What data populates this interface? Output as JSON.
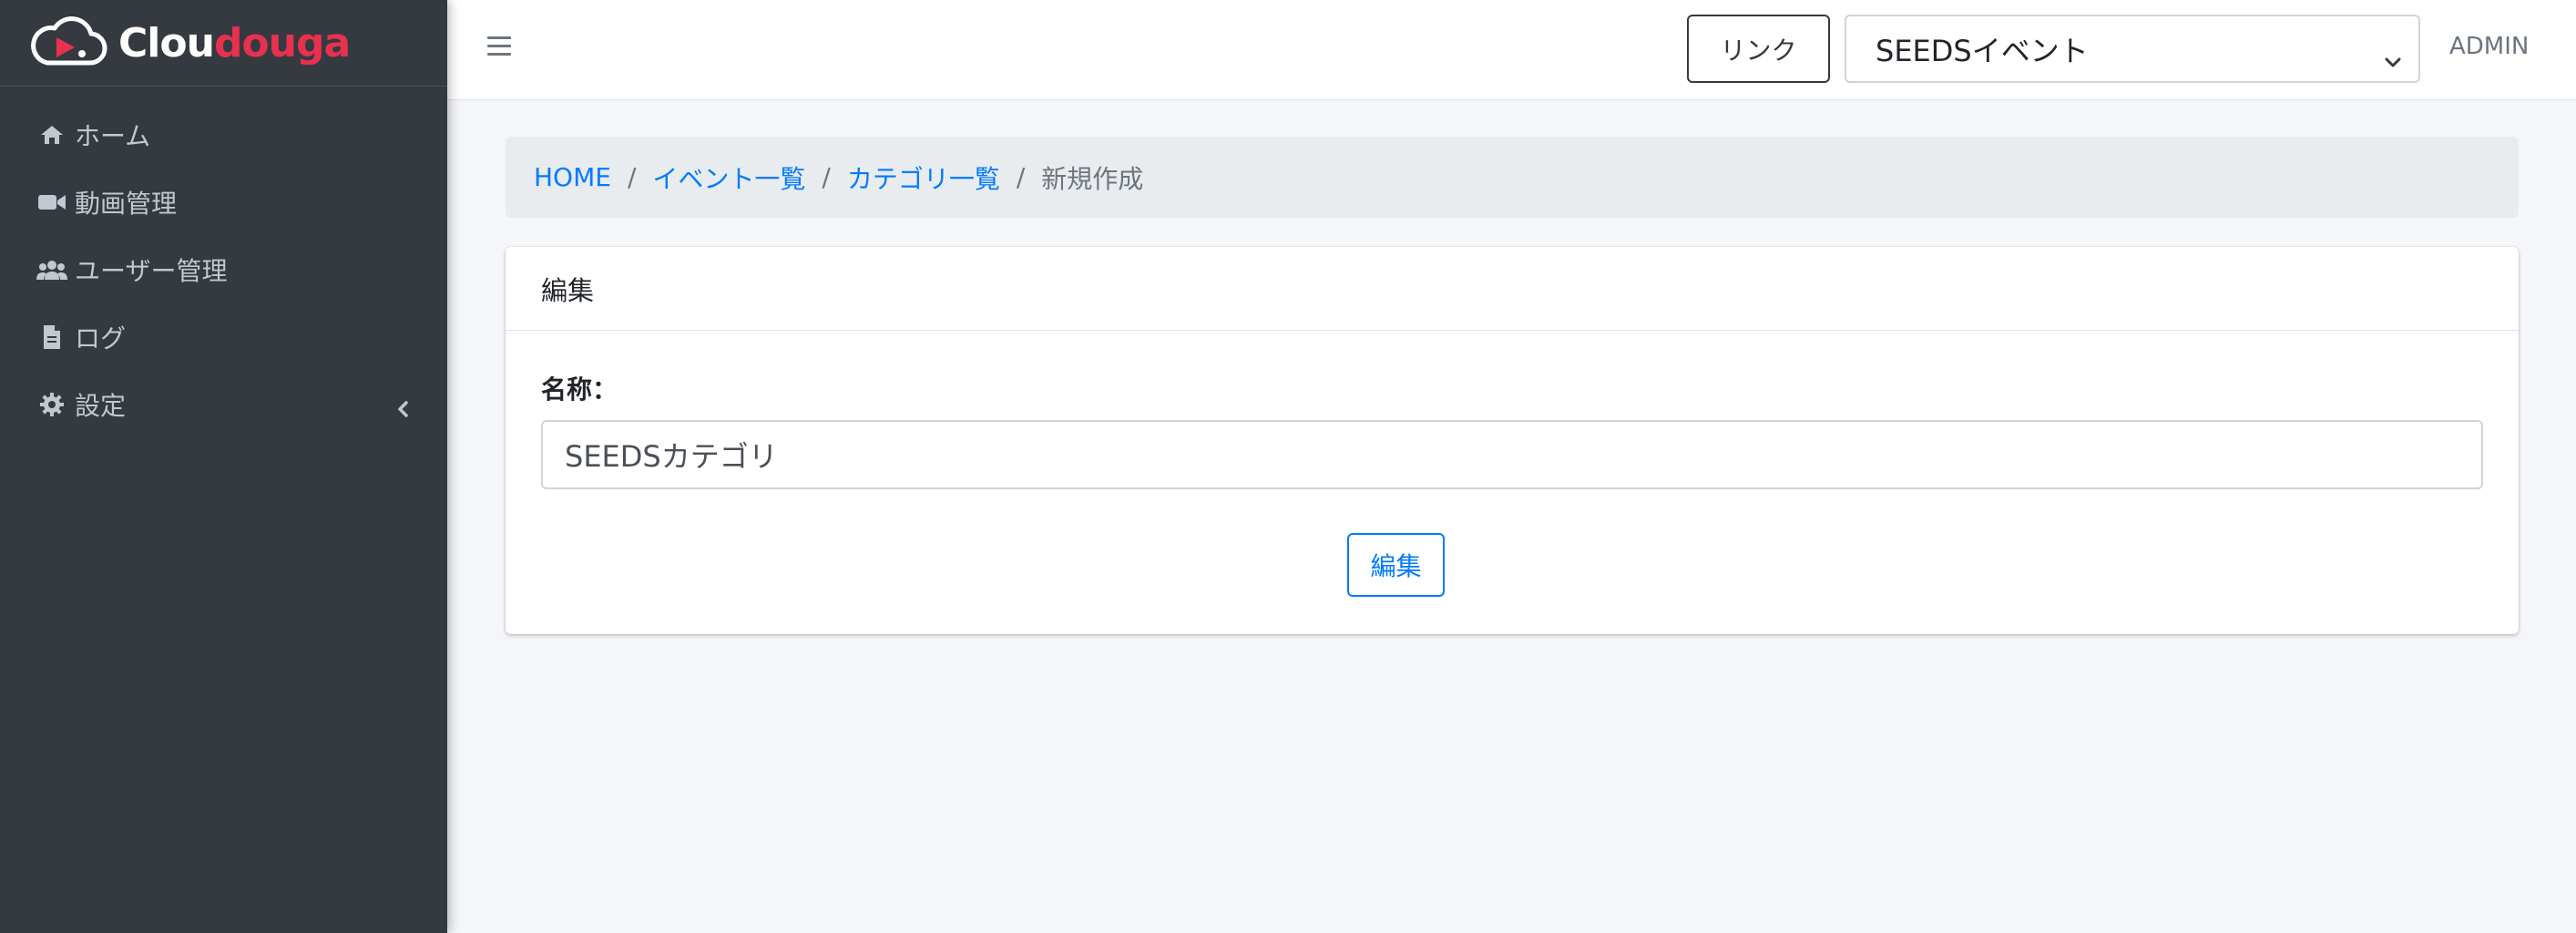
{
  "brand": {
    "name_white": "Clou",
    "name_red": "douga"
  },
  "sidebar": {
    "items": [
      {
        "label": "ホーム",
        "icon": "home-icon"
      },
      {
        "label": "動画管理",
        "icon": "video-icon"
      },
      {
        "label": "ユーザー管理",
        "icon": "users-icon"
      },
      {
        "label": "ログ",
        "icon": "file-icon"
      },
      {
        "label": "設定",
        "icon": "gear-icon"
      }
    ]
  },
  "header": {
    "link_label": "リンク",
    "event_select_value": "SEEDSイベント",
    "user_label": "ADMIN"
  },
  "breadcrumb": {
    "items": [
      "HOME",
      "イベント一覧",
      "カテゴリ一覧"
    ],
    "separator": "/",
    "current": "新規作成"
  },
  "card": {
    "title": "編集",
    "name_label": "名称：",
    "name_value": "SEEDSカテゴリ",
    "submit_label": "編集"
  },
  "colors": {
    "sidebar_bg": "#343a40",
    "accent": "#007bff",
    "brand_red": "#e8304f",
    "page_bg": "#f4f6f9"
  }
}
